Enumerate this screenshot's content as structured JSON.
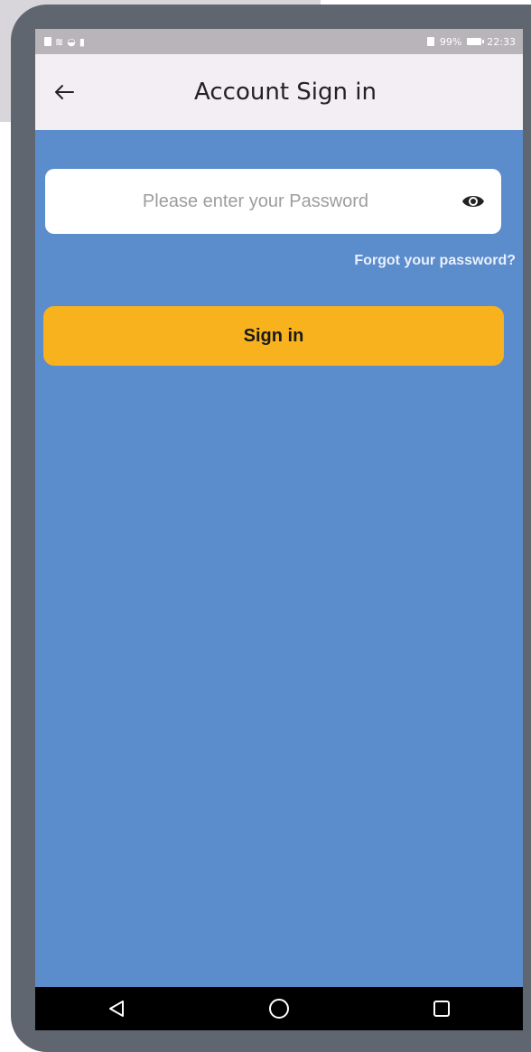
{
  "status_bar": {
    "battery_percent": "99%",
    "time": "22:33"
  },
  "app_bar": {
    "title": "Account Sign in",
    "back_icon": "arrow-left-icon"
  },
  "password_field": {
    "value": "",
    "placeholder": "Please enter your Password",
    "toggle_icon": "eye-icon"
  },
  "forgot_password_link": "Forgot your password?",
  "sign_in_button": {
    "label": "Sign in",
    "color": "#f7b21e"
  },
  "nav_bar": {
    "buttons": [
      "back-triangle-icon",
      "home-circle-icon",
      "recents-square-icon"
    ]
  },
  "colors": {
    "screen_background": "#5b8ccc",
    "app_bar_background": "#f2eef4"
  }
}
